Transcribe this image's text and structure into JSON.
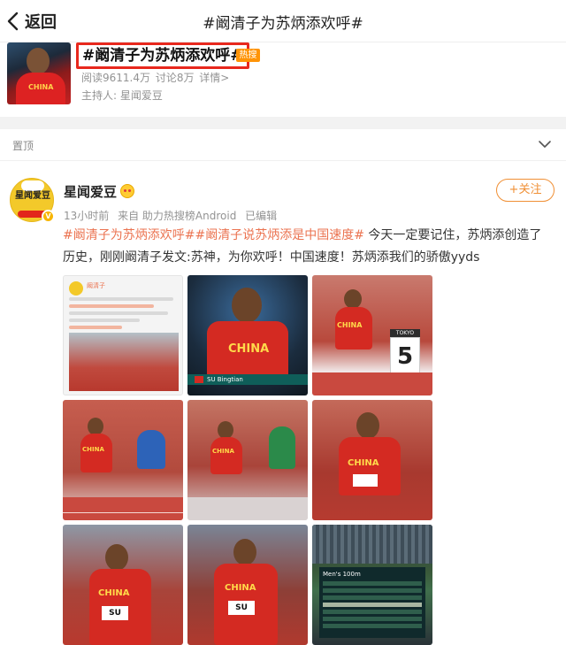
{
  "nav": {
    "back_label": "返回",
    "title": "#阚清子为苏炳添欢呼#"
  },
  "topic": {
    "title": "#阚清子为苏炳添欢呼#",
    "hot_badge": "热搜",
    "reads": "阅读9611.4万",
    "discussions": "讨论8万",
    "details_link": "详情>",
    "host_label": "主持人:",
    "host_name": "星闻爱豆",
    "thumb_jersey": "CHINA"
  },
  "pinned": {
    "label": "置顶"
  },
  "post": {
    "author": "星闻爱豆",
    "follow_label": "+关注",
    "meta": {
      "time": "13小时前",
      "source": "来自 助力热搜榜Android",
      "edited": "已编辑"
    },
    "hashtag1": "#阚清子为苏炳添欢呼#",
    "hashtag2": "#阚清子说苏炳添是中国速度#",
    "body": " 今天一定要记住，苏炳添创造了历史，刚刚阚清子发文:苏神，为你欢呼！中国速度！苏炳添我们的骄傲yyds",
    "avatar_text": "星闻爱豆",
    "images": {
      "screenshot_name": "阚清子",
      "jersey": "CHINA",
      "bib_name": "SU",
      "caption_name": "SU Bingtian",
      "lane_number": "5",
      "lane_header": "TOKYO 2020",
      "scoreboard_title": "Men's 100m"
    }
  },
  "colors": {
    "accent_orange": "#eb7350",
    "highlight_red": "#e8281d",
    "hot_badge": "#ff9406"
  }
}
